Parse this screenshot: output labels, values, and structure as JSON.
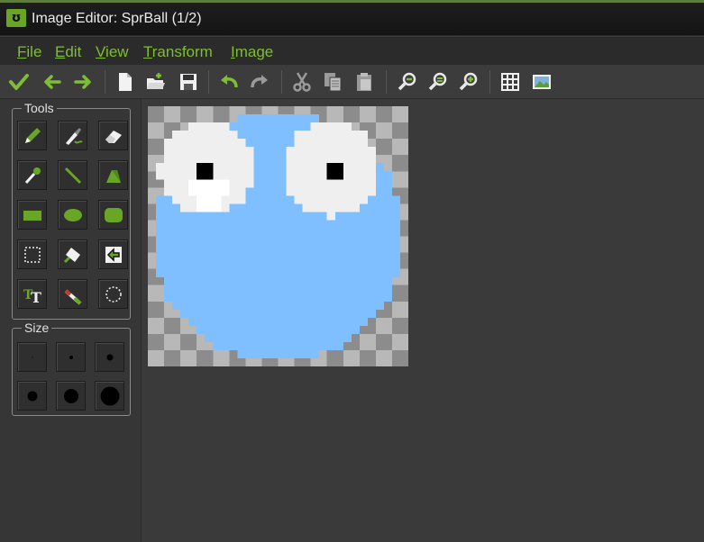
{
  "window": {
    "title": "Image Editor: SprBall (1/2)",
    "logo_glyph": "ʊ",
    "accent": "#7fbd33"
  },
  "menu": {
    "items": [
      {
        "first": "F",
        "rest": "ile"
      },
      {
        "first": "E",
        "rest": "dit"
      },
      {
        "first": "V",
        "rest": "iew"
      },
      {
        "first": "T",
        "rest": "ransform"
      },
      {
        "first": "I",
        "rest": "mage"
      }
    ]
  },
  "toolbar": {
    "icons": [
      "confirm-check-icon",
      "undo-arrow-icon",
      "redo-arrow-icon",
      "new-file-icon",
      "open-file-icon",
      "save-icon",
      "undo-icon",
      "redo-icon",
      "cut-icon",
      "copy-icon",
      "paste-icon",
      "zoom-out-icon",
      "zoom-reset-icon",
      "zoom-in-icon",
      "grid-icon",
      "background-image-icon"
    ]
  },
  "tools_panel": {
    "label": "Tools",
    "tools": [
      "pencil",
      "spray",
      "eraser",
      "color-picker",
      "line",
      "polygon",
      "rectangle",
      "ellipse",
      "rounded-rectangle",
      "selection",
      "magic-wand",
      "fill",
      "text",
      "line-eraser",
      "circle-selection"
    ]
  },
  "size_panel": {
    "label": "Size",
    "sizes": [
      1,
      2,
      3,
      4,
      5,
      6
    ]
  },
  "sprite": {
    "name": "SprBall",
    "body_color": "#7fbfff",
    "eye_color": "#efefef",
    "pupil_color": "#000000"
  }
}
